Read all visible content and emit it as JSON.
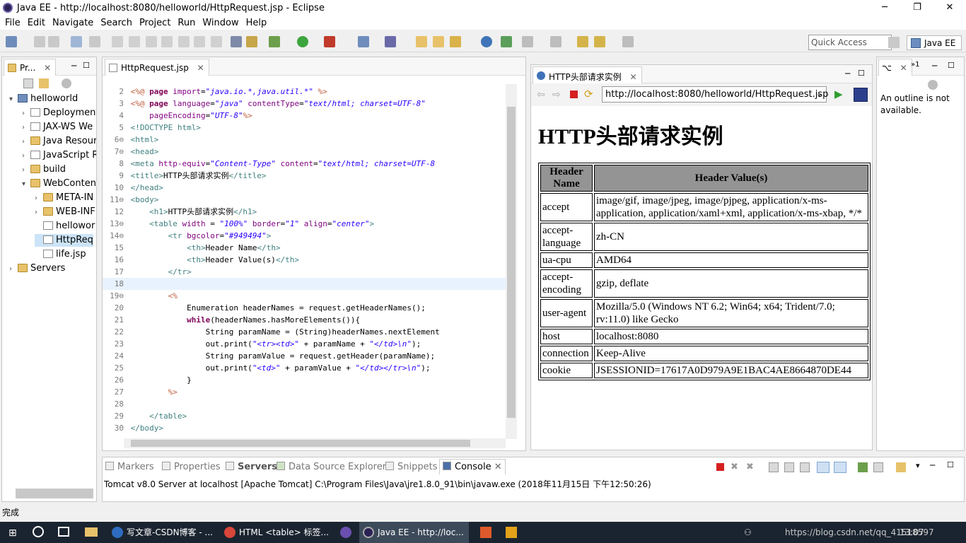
{
  "window": {
    "title": "Java EE - http://localhost:8080/helloworld/HttpRequest.jsp - Eclipse"
  },
  "menu": [
    "File",
    "Edit",
    "Navigate",
    "Search",
    "Project",
    "Run",
    "Window",
    "Help"
  ],
  "toolbar": {
    "quick_access": "Quick Access",
    "perspective": "Java EE"
  },
  "explorer": {
    "tab": "Pr...",
    "items": [
      {
        "label": "helloworld",
        "depth": 0,
        "icon": "project-icon",
        "arrow": "▾"
      },
      {
        "label": "Deployment",
        "depth": 1,
        "icon": "file-icon",
        "arrow": "›"
      },
      {
        "label": "JAX-WS We",
        "depth": 1,
        "icon": "file-icon",
        "arrow": "›"
      },
      {
        "label": "Java Resour",
        "depth": 1,
        "icon": "folder-icon",
        "arrow": "›"
      },
      {
        "label": "JavaScript R",
        "depth": 1,
        "icon": "file-icon",
        "arrow": "›"
      },
      {
        "label": "build",
        "depth": 1,
        "icon": "folder-icon",
        "arrow": "›"
      },
      {
        "label": "WebConten",
        "depth": 1,
        "icon": "folder-icon",
        "arrow": "▾"
      },
      {
        "label": "META-IN",
        "depth": 2,
        "icon": "folder-icon",
        "arrow": "›"
      },
      {
        "label": "WEB-INF",
        "depth": 2,
        "icon": "folder-icon",
        "arrow": "›"
      },
      {
        "label": "hellowor",
        "depth": 2,
        "icon": "file-icon",
        "arrow": ""
      },
      {
        "label": "HttpReq",
        "depth": 2,
        "icon": "file-icon",
        "arrow": ""
      },
      {
        "label": "life.jsp",
        "depth": 2,
        "icon": "file-icon",
        "arrow": ""
      },
      {
        "label": "Servers",
        "depth": 0,
        "icon": "folder-icon",
        "arrow": "›"
      }
    ]
  },
  "editor": {
    "tab": "HttpRequest.jsp",
    "lines": [
      {
        "n": "2",
        "html": "<span class=\"dir\">&lt;%@</span> <span class=\"k\">page</span> <span class=\"attr\">import</span>=<span class=\"str\">\"java.io.*,java.util.*\"</span> <span class=\"dir\">%&gt;</span>"
      },
      {
        "n": "3",
        "html": "<span class=\"dir\">&lt;%@</span> <span class=\"k\">page</span> <span class=\"attr\">language</span>=<span class=\"str\">\"java\"</span> <span class=\"attr\">contentType</span>=<span class=\"str\">\"text/html; charset=UTF-8\"</span>"
      },
      {
        "n": "4",
        "html": "    <span class=\"attr\">pageEncoding</span>=<span class=\"str\">\"UTF-8\"</span><span class=\"dir\">%&gt;</span>"
      },
      {
        "n": "5",
        "html": "<span class=\"tag\">&lt;!DOCTYPE html&gt;</span>"
      },
      {
        "n": "6⊖",
        "html": "<span class=\"tag\">&lt;html&gt;</span>"
      },
      {
        "n": "7⊖",
        "html": "<span class=\"tag\">&lt;head&gt;</span>"
      },
      {
        "n": "8",
        "html": "<span class=\"tag\">&lt;meta</span> <span class=\"attr\">http-equiv</span>=<span class=\"str\">\"Content-Type\"</span> <span class=\"attr\">content</span>=<span class=\"str\">\"text/html; charset=UTF-8</span>"
      },
      {
        "n": "9",
        "html": "<span class=\"tag\">&lt;title&gt;</span>HTTP头部请求实例<span class=\"tag\">&lt;/title&gt;</span>"
      },
      {
        "n": "10",
        "html": "<span class=\"tag\">&lt;/head&gt;</span>"
      },
      {
        "n": "11⊖",
        "html": "<span class=\"tag\">&lt;body&gt;</span>"
      },
      {
        "n": "12",
        "html": "    <span class=\"tag\">&lt;h1&gt;</span>HTTP头部请求实例<span class=\"tag\">&lt;/h1&gt;</span>"
      },
      {
        "n": "13⊖",
        "html": "    <span class=\"tag\">&lt;table</span> <span class=\"attr\">width</span> = <span class=\"str\">\"100%\"</span> <span class=\"attr\">border</span>=<span class=\"str\">\"1\"</span> <span class=\"attr\">align</span>=<span class=\"str\">\"center\"</span><span class=\"tag\">&gt;</span>"
      },
      {
        "n": "14⊖",
        "html": "        <span class=\"tag\">&lt;tr</span> <span class=\"attr\">bgcolor</span>=<span class=\"str\">\"#949494\"</span><span class=\"tag\">&gt;</span>"
      },
      {
        "n": "15",
        "html": "            <span class=\"tag\">&lt;th&gt;</span>Header Name<span class=\"tag\">&lt;/th&gt;</span>"
      },
      {
        "n": "16",
        "html": "            <span class=\"tag\">&lt;th&gt;</span>Header Value(s)<span class=\"tag\">&lt;/th&gt;</span>"
      },
      {
        "n": "17",
        "html": "        <span class=\"tag\">&lt;/tr&gt;</span>"
      },
      {
        "n": "18",
        "html": ""
      },
      {
        "n": "19⊖",
        "html": "        <span class=\"dir\">&lt;%</span>"
      },
      {
        "n": "20",
        "html": "            Enumeration headerNames = request.getHeaderNames();"
      },
      {
        "n": "21",
        "html": "            <span class=\"k\">while</span>(headerNames.hasMoreElements()){"
      },
      {
        "n": "22",
        "html": "                String paramName = (String)headerNames.nextElement"
      },
      {
        "n": "23",
        "html": "                out.print(<span class=\"str\">\"&lt;tr&gt;&lt;td&gt;\"</span> + paramName + <span class=\"str\">\"&lt;/td&gt;\\n\"</span>);"
      },
      {
        "n": "24",
        "html": "                String paramValue = request.getHeader(paramName);"
      },
      {
        "n": "25",
        "html": "                out.print(<span class=\"str\">\"&lt;td&gt;\"</span> + paramValue + <span class=\"str\">\"&lt;/td&gt;&lt;/tr&gt;\\n\"</span>);"
      },
      {
        "n": "26",
        "html": "            }"
      },
      {
        "n": "27",
        "html": "        <span class=\"dir\">%&gt;</span>"
      },
      {
        "n": "28",
        "html": ""
      },
      {
        "n": "29",
        "html": "    <span class=\"tag\">&lt;/table&gt;</span>"
      },
      {
        "n": "30",
        "html": "<span class=\"tag\">&lt;/body&gt;</span>"
      }
    ]
  },
  "browser": {
    "tab": "HTTP头部请求实例",
    "url": "http://localhost:8080/helloworld/HttpRequest.jsp",
    "h1": "HTTP头部请求实例",
    "headers": [
      "Header Name",
      "Header Value(s)"
    ],
    "rows": [
      {
        "name": "accept",
        "value": "image/gif, image/jpeg, image/pjpeg, application/x-ms-application, application/xaml+xml, application/x-ms-xbap, */*"
      },
      {
        "name": "accept-language",
        "value": "zh-CN"
      },
      {
        "name": "ua-cpu",
        "value": "AMD64"
      },
      {
        "name": "accept-encoding",
        "value": "gzip, deflate"
      },
      {
        "name": "user-agent",
        "value": "Mozilla/5.0 (Windows NT 6.2; Win64; x64; Trident/7.0; rv:11.0) like Gecko"
      },
      {
        "name": "host",
        "value": "localhost:8080"
      },
      {
        "name": "connection",
        "value": "Keep-Alive"
      },
      {
        "name": "cookie",
        "value": "JSESSIONID=17617A0D979A9E1BAC4AE8664870DE44"
      }
    ]
  },
  "outline": {
    "tab": "",
    "message": "An outline is not available."
  },
  "bottom": {
    "tabs": [
      "Markers",
      "Properties",
      "Servers",
      "Data Source Explorer",
      "Snippets",
      "Console"
    ],
    "console_line": "Tomcat v8.0 Server at localhost [Apache Tomcat] C:\\Program Files\\Java\\jre1.8.0_91\\bin\\javaw.exe (2018年11月15日 下午12:50:26)"
  },
  "status": {
    "text": "完成"
  },
  "taskbar": {
    "items": [
      "写文章-CSDN博客 - ...",
      "HTML <table> 标签...",
      "Java EE - http://loc..."
    ],
    "watermark": "https://blog.csdn.net/qq_41518597",
    "time": "13:07"
  },
  "colors": {
    "accent": "#949494",
    "taskbar": "#1a2430",
    "link": "#2a00ff"
  }
}
